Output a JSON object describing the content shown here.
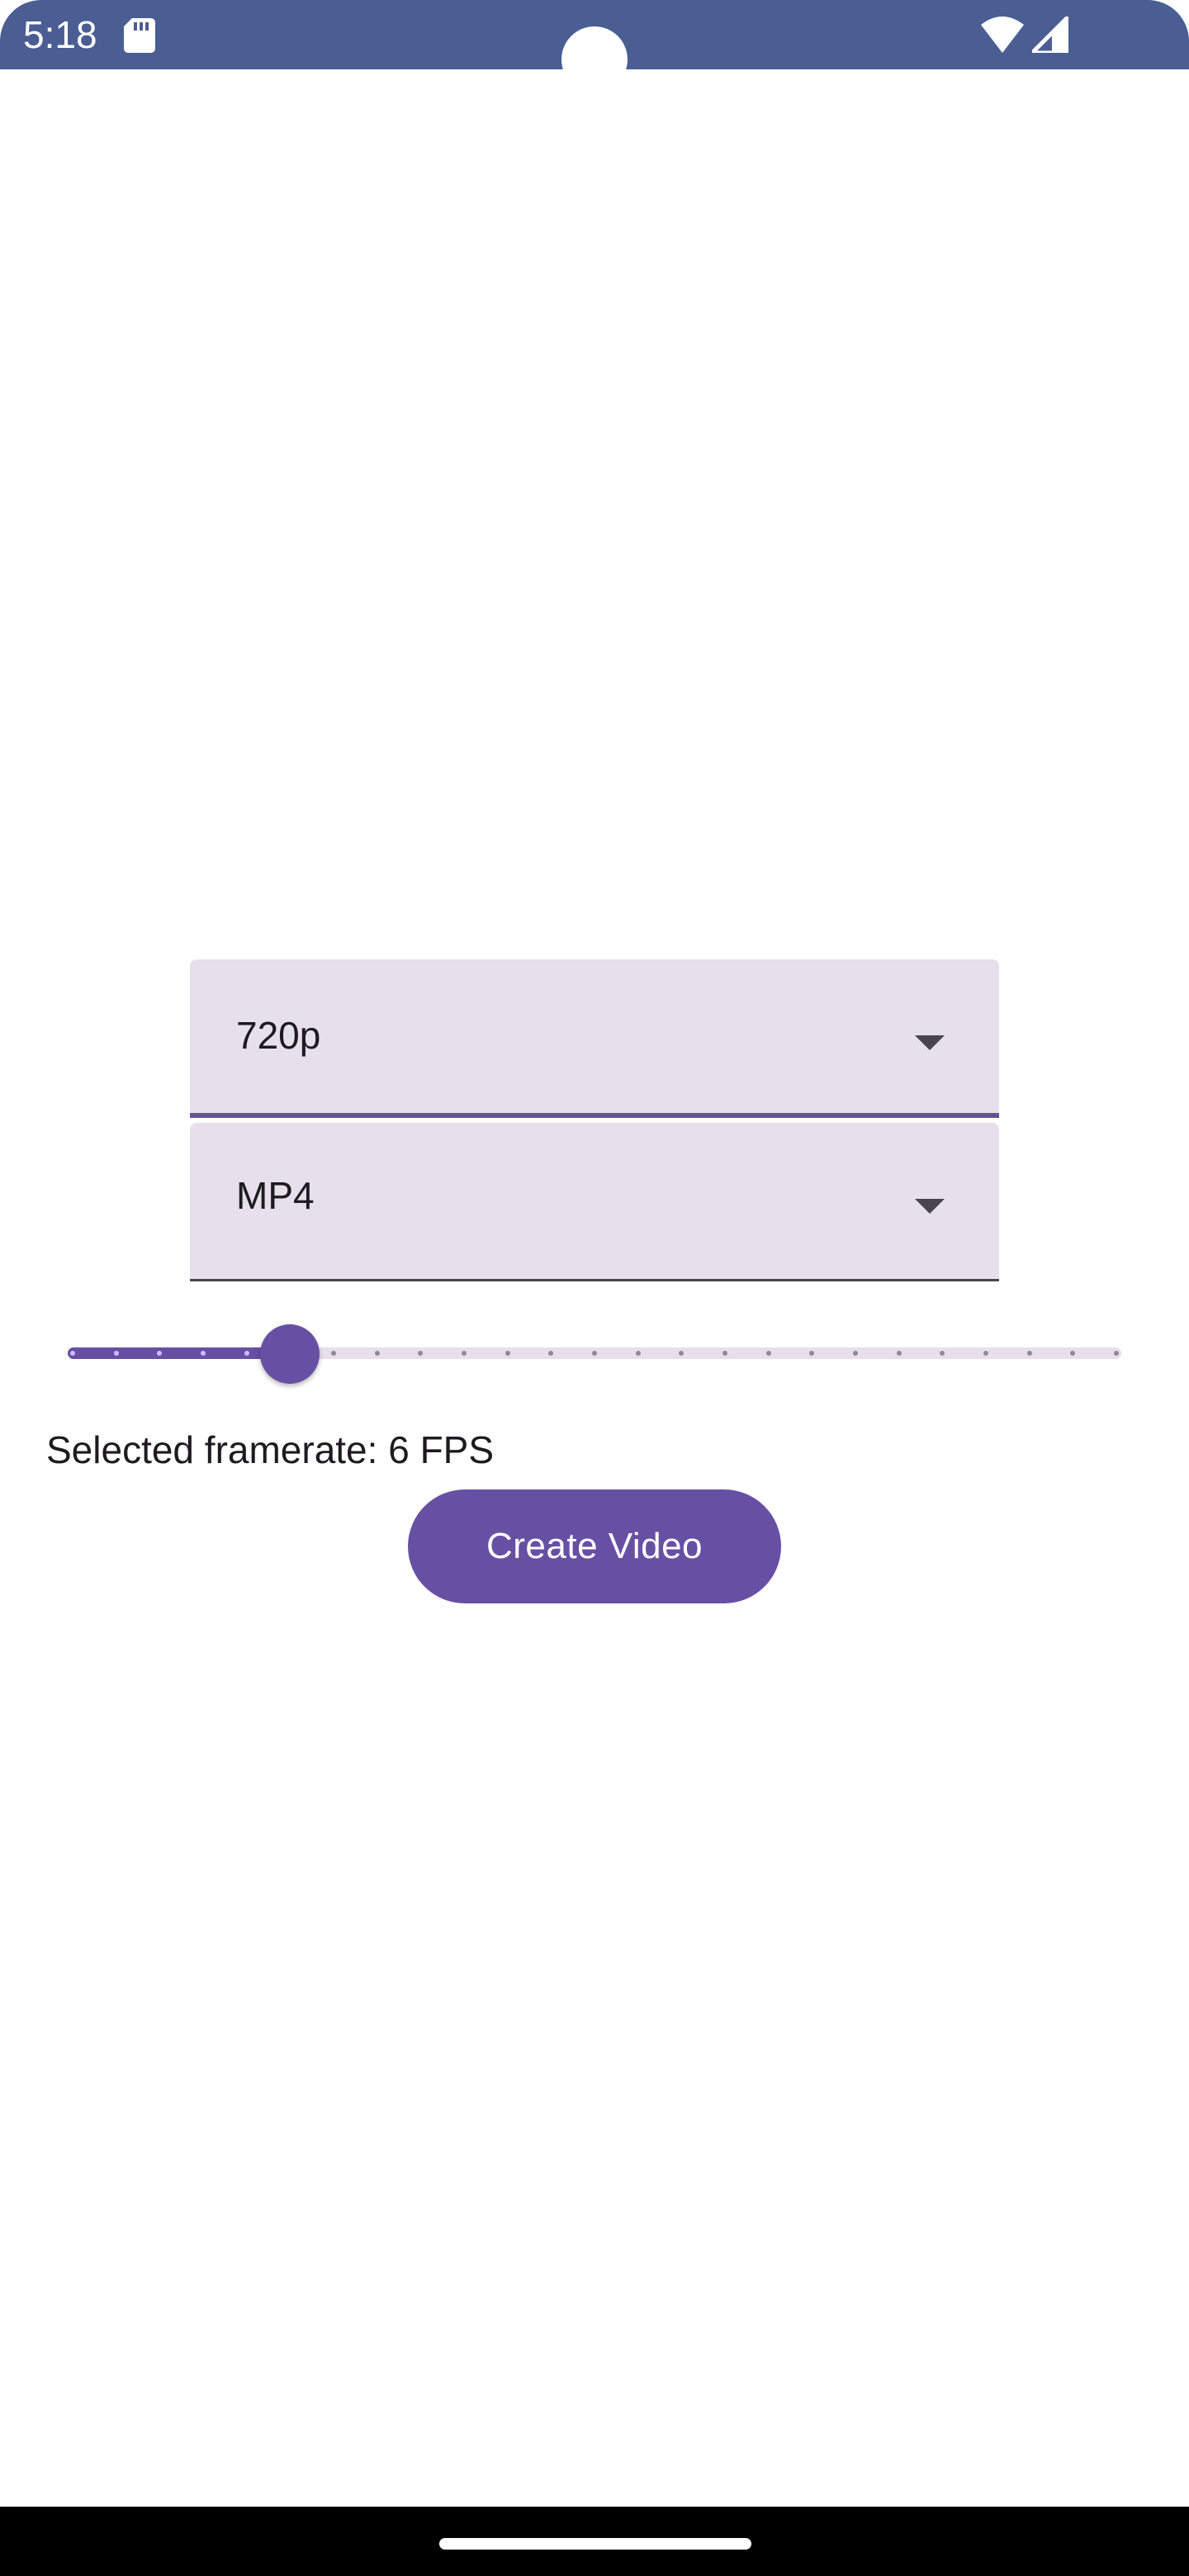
{
  "status_bar": {
    "time": "5:18",
    "background": "#4a5e94",
    "icons": [
      "sd-card-icon",
      "wifi-icon",
      "signal-icon"
    ]
  },
  "resolution_dropdown": {
    "value": "720p",
    "state": "focused"
  },
  "format_dropdown": {
    "value": "MP4"
  },
  "framerate_slider": {
    "min": 1,
    "max": 25,
    "value": 6,
    "steps": 25
  },
  "framerate_label": "Selected framerate: 6 FPS",
  "create_button": {
    "label": "Create Video"
  },
  "theme": {
    "primary": "#6750a4",
    "field_background": "#e7dfec",
    "on_surface": "#1d1b20"
  }
}
